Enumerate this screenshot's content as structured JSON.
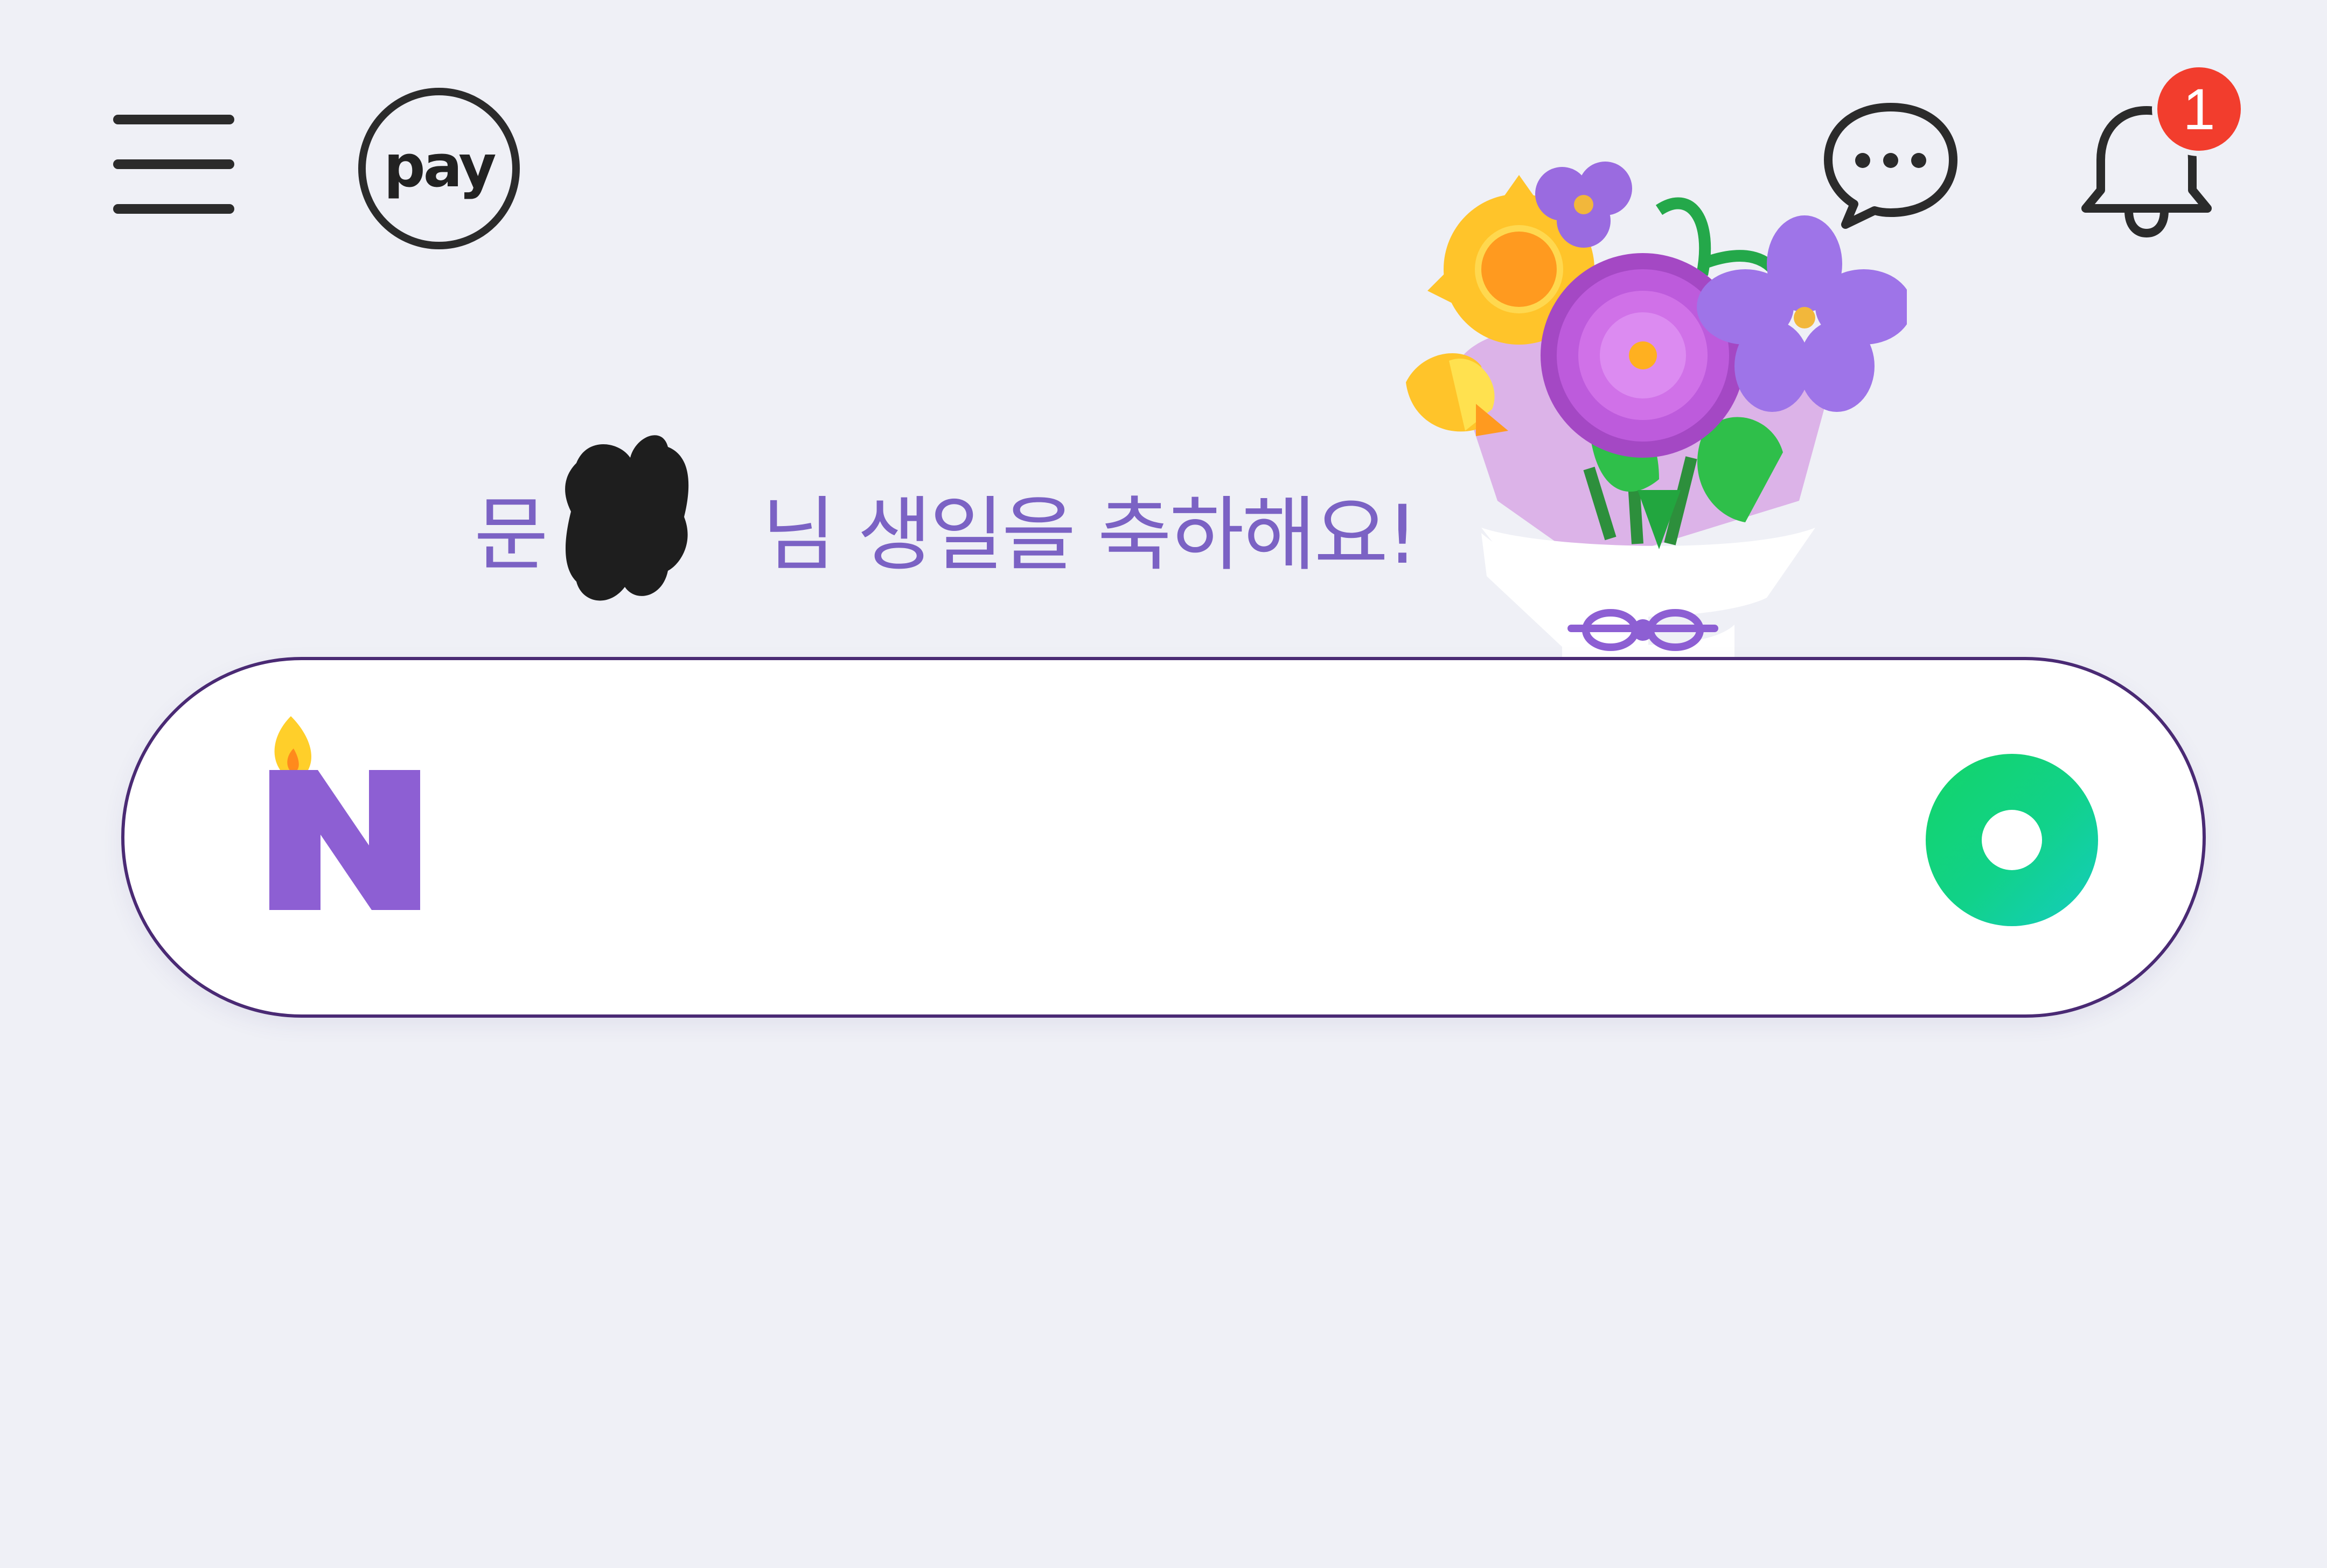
{
  "header": {
    "menu_icon": "hamburger-menu-icon",
    "pay_label": "pay",
    "chat_icon": "chat-bubble-icon",
    "bell_icon": "notification-bell-icon",
    "notification_count": "1"
  },
  "greeting": {
    "prefix": "문",
    "suffix": "님 생일을 축하해요!"
  },
  "search": {
    "placeholder": "",
    "value": "",
    "logo_icon": "naver-birthday-n-logo-icon",
    "action_icon": "green-search-circle-icon"
  },
  "decoration": {
    "bouquet_icon": "flower-bouquet-icon"
  },
  "colors": {
    "background": "#eff0f6",
    "greeting_text": "#7b62c4",
    "badge": "#f23d2d",
    "search_border": "#4a2a74",
    "accent_green": "#13d468",
    "logo_purple": "#8d5fd3"
  }
}
